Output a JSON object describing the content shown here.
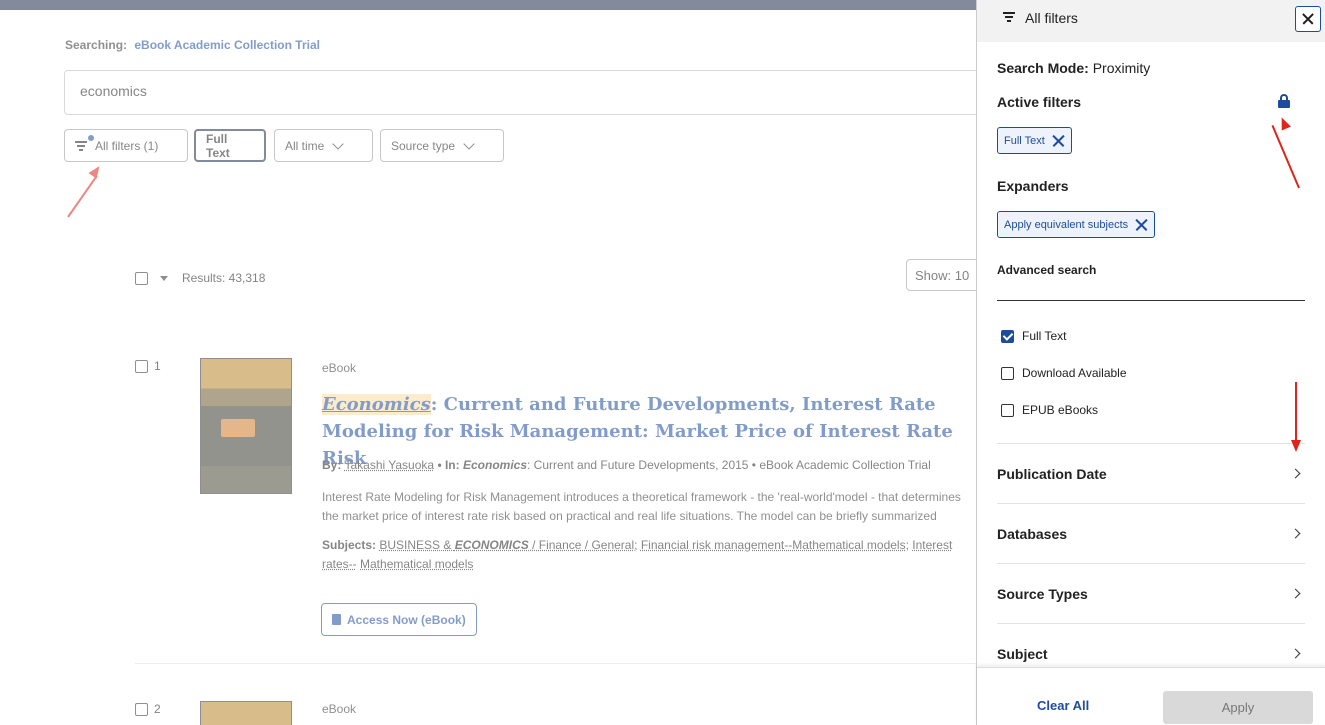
{
  "searching": {
    "label": "Searching:",
    "collection": "eBook Academic Collection Trial"
  },
  "search": {
    "value": "economics"
  },
  "filters_bar": {
    "all_filters": "All filters (1)",
    "full_text": "Full Text",
    "all_time": "All time",
    "source_type": "Source type"
  },
  "results": {
    "count_label": "Results: 43,318",
    "show_label": "Show: 10"
  },
  "items": [
    {
      "number": "1",
      "type": "eBook",
      "title_highlight": "Economics",
      "title_rest": ": Current and Future Developments, Interest Rate Modeling for Risk Management: Market Price of Interest Rate Risk",
      "by_label": "By:",
      "author": "Takashi Yasuoka",
      "in_label": "• In:",
      "in_highlight": "Economics",
      "in_rest": ": Current and Future Developments, 2015 • eBook Academic Collection Trial",
      "abstract": "Interest Rate Modeling for Risk Management introduces a theoretical framework - the 'real-world'model - that determines the market price of interest rate risk based on practical and real life situations. The model can be briefly summarized",
      "subjects_label": "Subjects:",
      "subject_1_pre": "BUSINESS &",
      "subject_1_hl": "ECONOMICS",
      "subject_1_post": "/ Finance / General;",
      "subject_2": "Financial risk management--Mathematical models;",
      "subject_3": "Interest rates--",
      "subject_4": "Mathematical models",
      "access": "Access Now (eBook)"
    },
    {
      "number": "2",
      "type": "eBook"
    }
  ],
  "panel": {
    "title": "All filters",
    "mode_label": "Search Mode:",
    "mode_value": "Proximity",
    "active_filters": "Active filters",
    "active_chip": "Full Text",
    "expanders": "Expanders",
    "expander_chip": "Apply equivalent subjects",
    "advanced": "Advanced search",
    "checkboxes": [
      {
        "label": "Full Text",
        "checked": true
      },
      {
        "label": "Download Available",
        "checked": false
      },
      {
        "label": "EPUB eBooks",
        "checked": false
      }
    ],
    "sections": [
      "Publication Date",
      "Databases",
      "Source Types",
      "Subject"
    ],
    "clear_all": "Clear All",
    "apply": "Apply"
  },
  "colors": {
    "accent": "#1d4c9e",
    "topbar": "#1c2b4a",
    "annotation": "#e0241b",
    "highlight": "#fcdca0"
  }
}
